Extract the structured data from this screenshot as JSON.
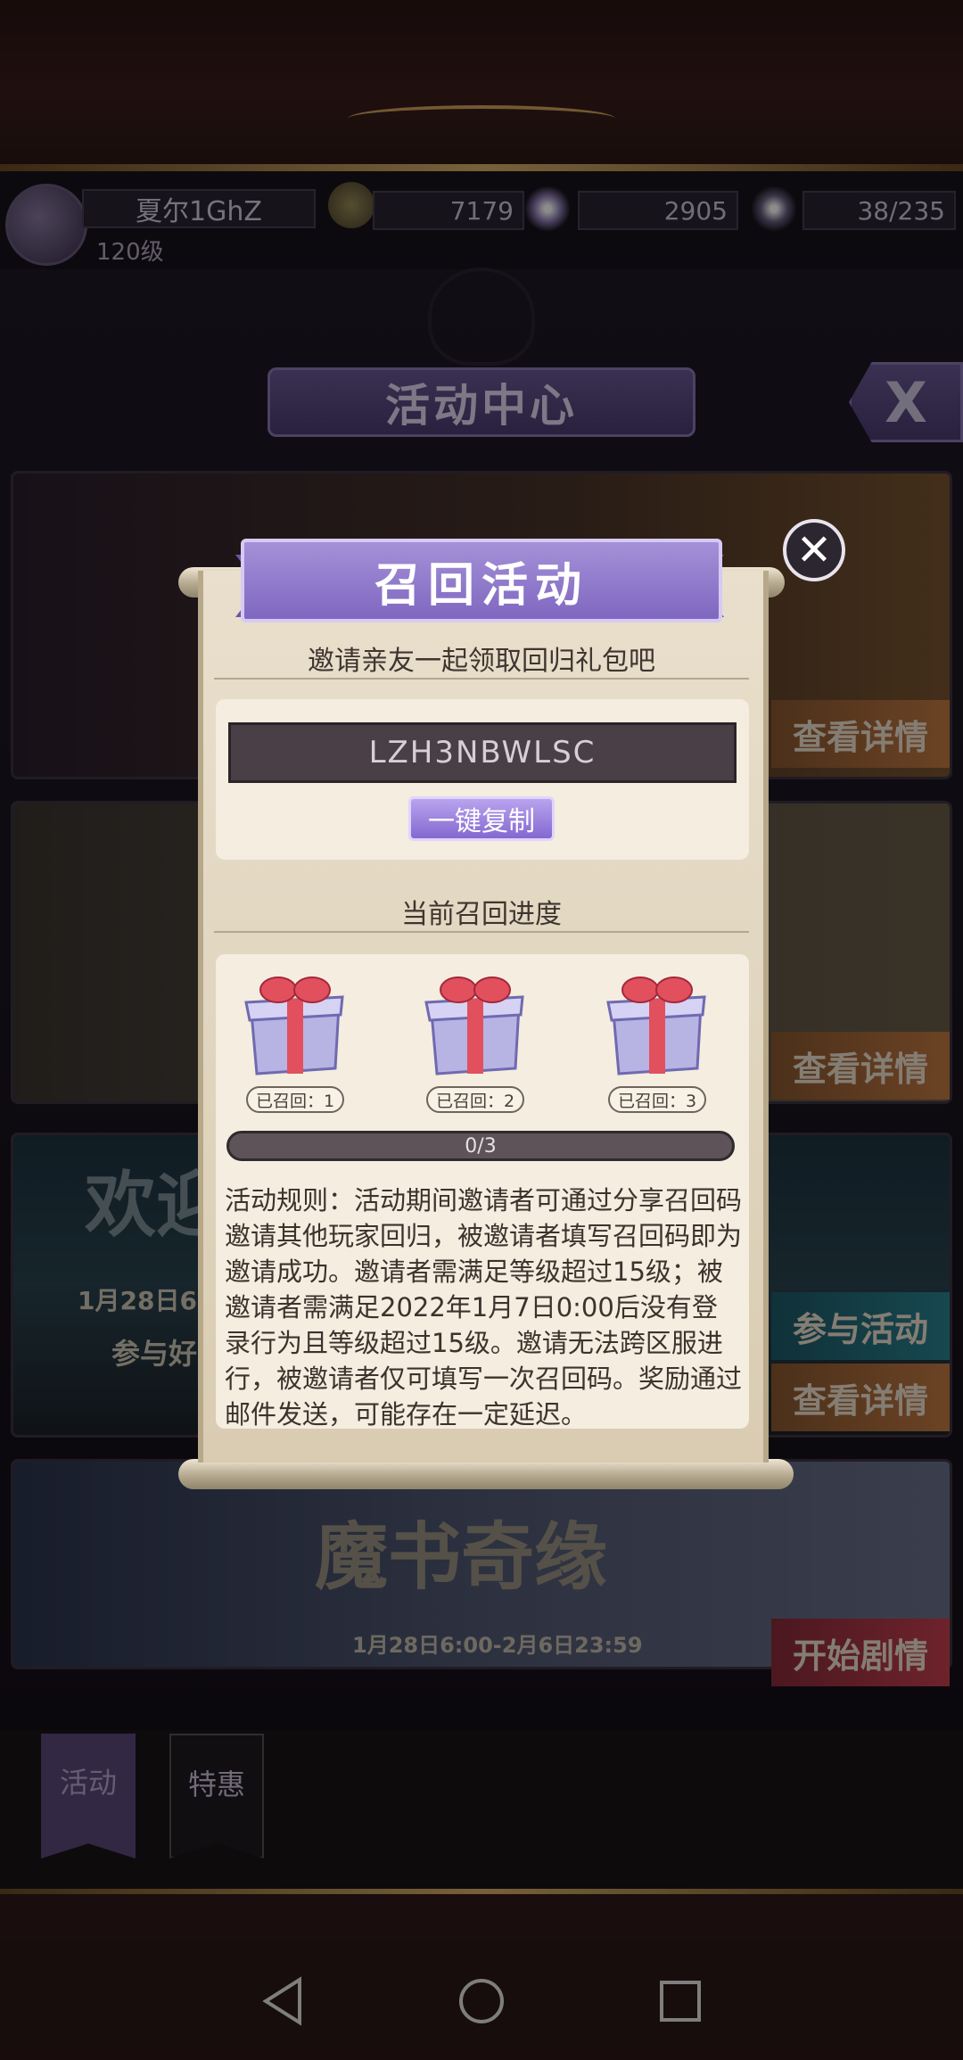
{
  "player": {
    "nickname": "夏尔1GhZ",
    "level": "120级"
  },
  "resources": {
    "gold": "7179",
    "diamonds": "2905",
    "stamina": "38/235"
  },
  "activity_center": {
    "title": "活动中心",
    "close_label": "X",
    "cards": [
      {
        "button": "查看详情"
      },
      {
        "button": "查看详情"
      },
      {
        "title_partial": "欢迎",
        "date_partial": "1月28日6",
        "sub_partial": "参与好",
        "button_join": "参与活动",
        "button": "查看详情"
      },
      {
        "title": "魔书奇缘",
        "date": "1月28日6:00-2月6日23:59",
        "button": "开始剧情"
      }
    ]
  },
  "tabs": [
    {
      "label": "活动",
      "active": true
    },
    {
      "label": "特惠",
      "active": false
    }
  ],
  "dialog": {
    "title": "召回活动",
    "close_label": "✕",
    "subtitle": "邀请亲友一起领取回归礼包吧",
    "invite_code": "LZH3NBWLSC",
    "copy_button": "一键复制",
    "progress_title": "当前召回进度",
    "rewards": [
      {
        "label": "已召回：1",
        "icon": "gift-box-icon"
      },
      {
        "label": "已召回：2",
        "icon": "gift-box-icon"
      },
      {
        "label": "已召回：3",
        "icon": "gift-box-icon"
      }
    ],
    "progress": {
      "current": 0,
      "total": 3,
      "text": "0/3"
    },
    "rules": "活动规则：活动期间邀请者可通过分享召回码邀请其他玩家回归，被邀请者填写召回码即为邀请成功。邀请者需满足等级超过15级；被邀请者需满足2022年1月7日0:00后没有登录行为且等级超过15级。邀请无法跨区服进行，被邀请者仅可填写一次召回码。奖励通过邮件发送，可能存在一定延迟。"
  },
  "colors": {
    "accent_purple": "#8468d0",
    "button_orange": "#c47a43",
    "button_teal": "#2b8391",
    "button_red": "#c8404f"
  },
  "nav": {
    "back": "back-triangle-icon",
    "home": "home-circle-icon",
    "recents": "recents-square-icon"
  }
}
